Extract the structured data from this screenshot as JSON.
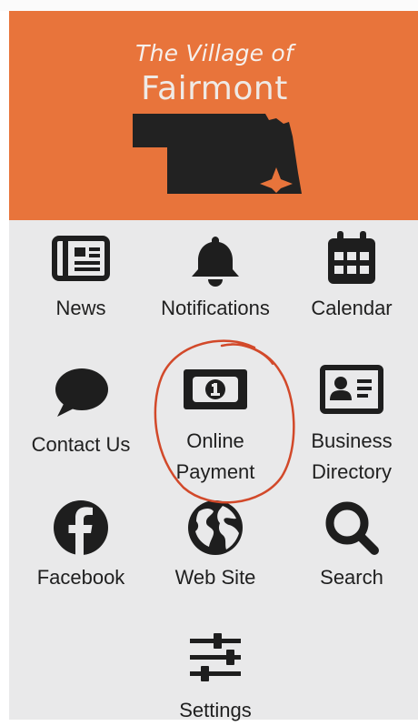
{
  "header": {
    "title_small": "The Village of",
    "title_large": "Fairmont"
  },
  "menu": {
    "news": "News",
    "notifications": "Notifications",
    "calendar": "Calendar",
    "contact": "Contact Us",
    "payment_line1": "Online",
    "payment_line2": "Payment",
    "business_line1": "Business",
    "business_line2": "Directory",
    "facebook": "Facebook",
    "website": "Web Site",
    "search": "Search",
    "settings": "Settings"
  },
  "icons": {
    "news": "newspaper-icon",
    "notifications": "bell-icon",
    "calendar": "calendar-icon",
    "contact": "speech-bubble-icon",
    "payment": "money-bill-icon",
    "business": "id-card-icon",
    "facebook": "facebook-icon",
    "website": "globe-icon",
    "search": "magnifier-icon",
    "settings": "sliders-icon"
  },
  "colors": {
    "header_bg": "#e8743b",
    "grid_bg": "#e9e9ea",
    "icon": "#1e1e1e",
    "annotation": "#d2492a"
  }
}
